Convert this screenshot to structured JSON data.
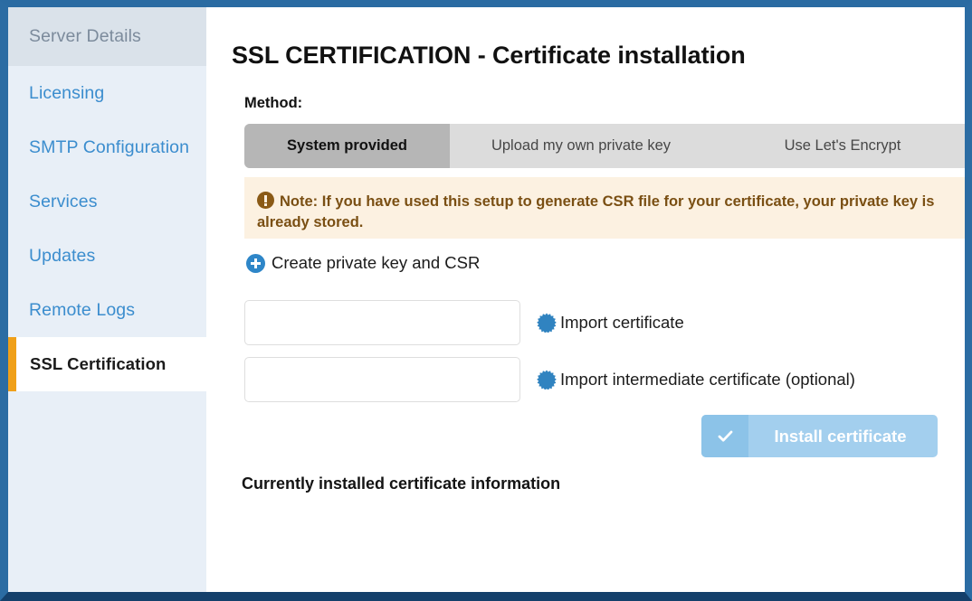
{
  "window": {
    "frame_color": "#2b6ca3",
    "frame_bottom_color": "#14406b"
  },
  "sidebar": {
    "accent_color": "#f0a019",
    "link_color": "#3b8dce",
    "background": "#e8eff7",
    "items": [
      {
        "label": "Server Details",
        "state": "muted"
      },
      {
        "label": "Licensing",
        "state": "normal"
      },
      {
        "label": "SMTP Configuration",
        "state": "normal"
      },
      {
        "label": "Services",
        "state": "normal"
      },
      {
        "label": "Updates",
        "state": "normal"
      },
      {
        "label": "Remote Logs",
        "state": "normal"
      },
      {
        "label": "SSL Certification",
        "state": "active"
      }
    ]
  },
  "main": {
    "title": "SSL CERTIFICATION - Certificate installation",
    "method_label": "Method:",
    "tabs": [
      {
        "label": "System provided",
        "active": true
      },
      {
        "label": "Upload my own private key",
        "active": false
      },
      {
        "label": "Use Let's Encrypt",
        "active": false
      }
    ],
    "note": {
      "icon": "exclamation-circle-icon",
      "text": "Note: If you have used this setup to generate CSR file for your certificate, your private key is already stored.",
      "background": "#fcf1e1",
      "text_color": "#7a4f13"
    },
    "create_key": {
      "icon": "plus-circle-icon",
      "label": "Create private key and CSR"
    },
    "imports": [
      {
        "input_value": "",
        "input_placeholder": "",
        "icon": "burst-upload-icon",
        "label": "Import certificate"
      },
      {
        "input_value": "",
        "input_placeholder": "",
        "icon": "burst-upload-icon",
        "label": "Import intermediate certificate (optional)"
      }
    ],
    "install_button": {
      "icon": "check-icon",
      "label": "Install certificate",
      "color": "#a3cfee",
      "disabled": true
    },
    "installed_info_heading": "Currently installed certificate information"
  }
}
